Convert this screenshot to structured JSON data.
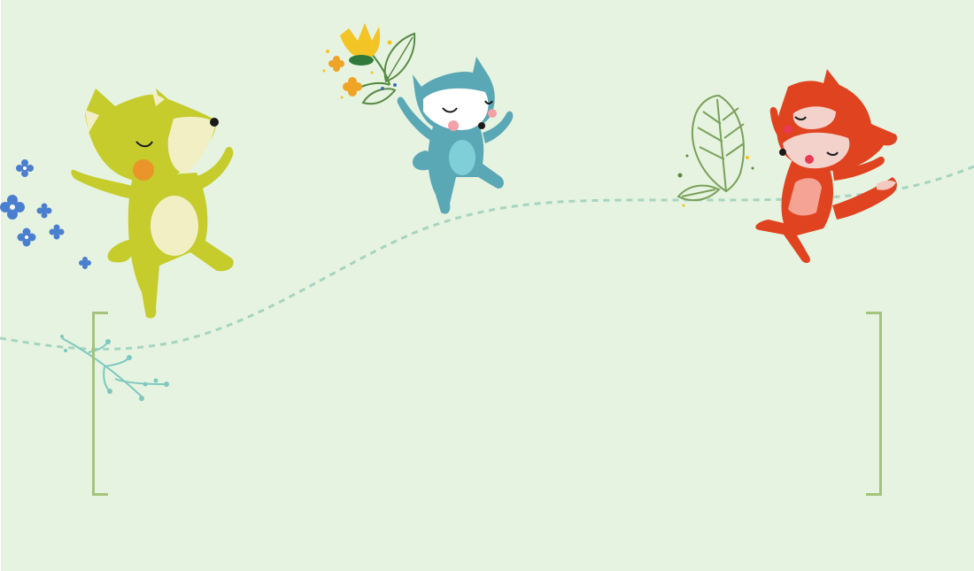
{
  "colors": {
    "background": "#e6f3e0",
    "bracket": "#a3c47a",
    "dashed_path": "#a6d4c0",
    "yellow_fox": "#c5cc2c",
    "blue_fox": "#5aa8b5",
    "red_fox": "#e0431f",
    "blue_flowers": "#4a7fcf",
    "yellow_flower": "#f2c524",
    "leaf_outline": "#7aa05a",
    "sprig": "#7ec8c0"
  },
  "illustrations": [
    "yellow-fox-dancing",
    "blue-fox-with-flowers",
    "red-fox-with-leaf",
    "blue-flower-cluster",
    "teal-sprig",
    "dashed-wavy-path"
  ],
  "frame": {
    "style": "square-brackets"
  }
}
